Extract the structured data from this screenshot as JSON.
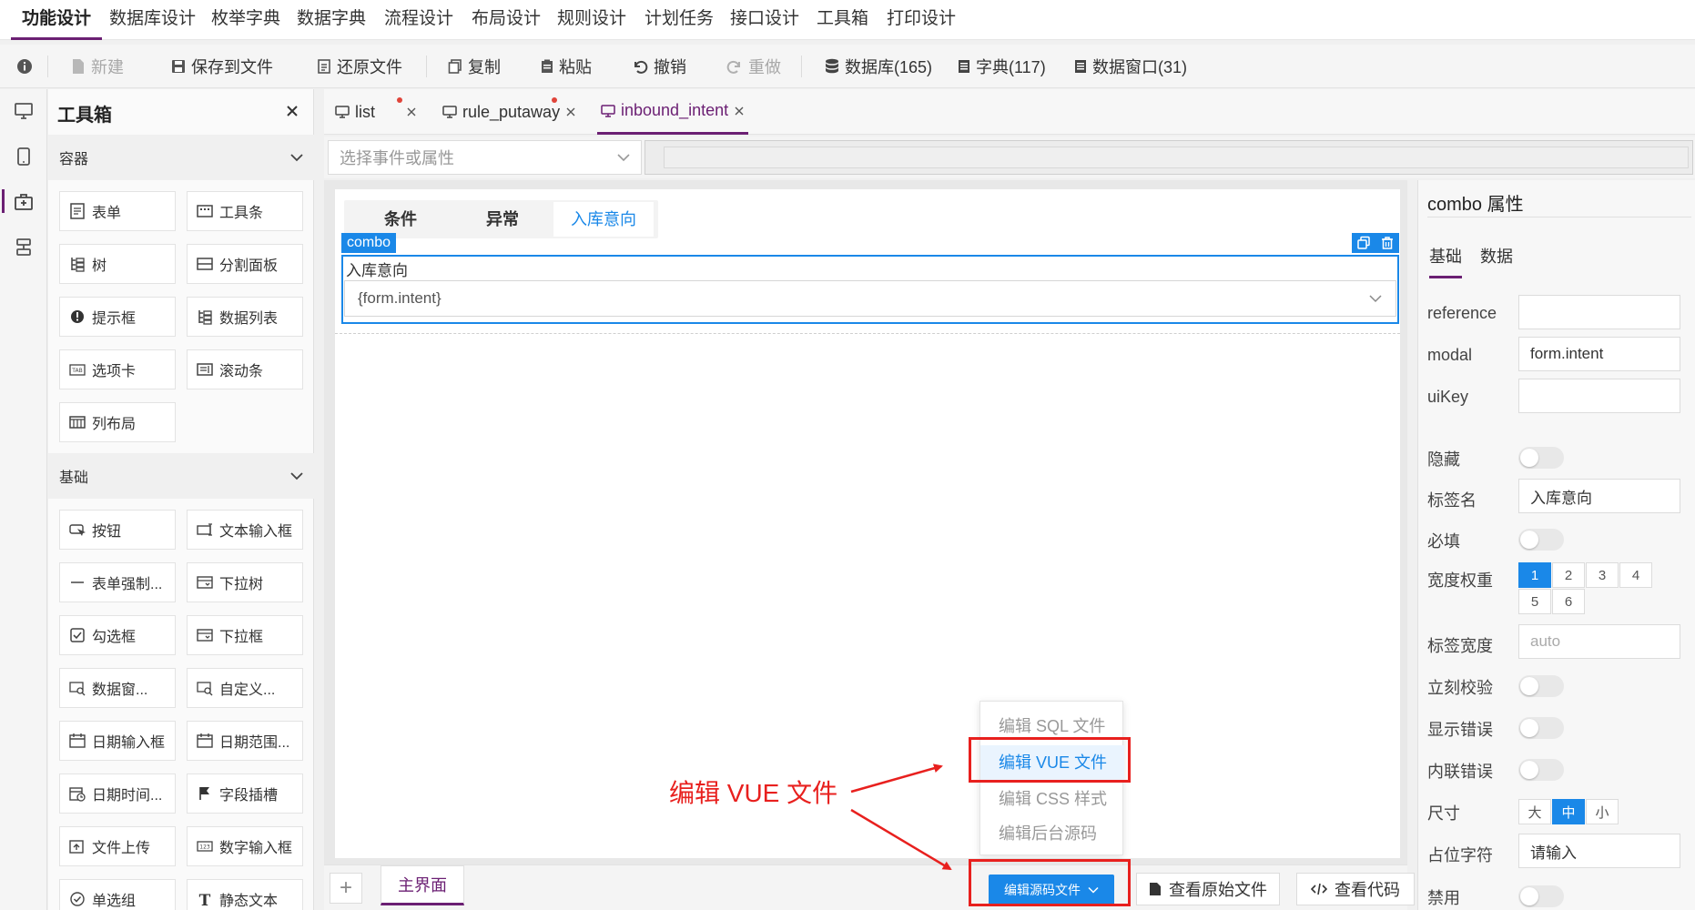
{
  "menu": [
    {
      "label": "功能设计",
      "active": true
    },
    {
      "label": "数据库设计"
    },
    {
      "label": "枚举字典"
    },
    {
      "label": "数据字典"
    },
    {
      "label": "流程设计"
    },
    {
      "label": "布局设计"
    },
    {
      "label": "规则设计"
    },
    {
      "label": "计划任务"
    },
    {
      "label": "接口设计"
    },
    {
      "label": "工具箱"
    },
    {
      "label": "打印设计"
    }
  ],
  "toolbar": {
    "new": "新建",
    "save": "保存到文件",
    "restore": "还原文件",
    "copy": "复制",
    "paste": "粘贴",
    "undo": "撤销",
    "redo": "重做",
    "database": "数据库(165)",
    "dictionary": "字典(117)",
    "data_window": "数据窗口(31)"
  },
  "toolbox": {
    "title": "工具箱",
    "sections": [
      {
        "title": "容器",
        "items": [
          "表单",
          "工具条",
          "树",
          "分割面板",
          "提示框",
          "数据列表",
          "选项卡",
          "滚动条",
          "列布局"
        ]
      },
      {
        "title": "基础",
        "items": [
          "按钮",
          "文本输入框",
          "表单强制...",
          "下拉树",
          "勾选框",
          "下拉框",
          "数据窗...",
          "自定义...",
          "日期输入框",
          "日期范围...",
          "日期时间...",
          "字段插槽",
          "文件上传",
          "数字输入框",
          "单选组",
          "静态文本"
        ]
      }
    ]
  },
  "doc_tabs": [
    {
      "label": "list",
      "modified": true
    },
    {
      "label": "rule_putaway",
      "modified": true
    },
    {
      "label": "inbound_intent",
      "active": true
    }
  ],
  "event_select": {
    "placeholder": "选择事件或属性"
  },
  "form_tabs": [
    "条件",
    "异常",
    "入库意向"
  ],
  "form_tab_active": 2,
  "combo": {
    "tag": "combo",
    "label": "入库意向",
    "value": "{form.intent}"
  },
  "bottom": {
    "add": "+",
    "page_tab": "主界面",
    "edit_source": "编辑源码文件",
    "view_original": "查看原始文件",
    "view_code": "查看代码"
  },
  "dropdown": {
    "items": [
      "编辑 SQL 文件",
      "编辑 VUE 文件",
      "编辑 CSS 样式",
      "编辑后台源码"
    ],
    "hover_index": 1
  },
  "annotation": {
    "text": "编辑 VUE 文件",
    "color": "#e8201e"
  },
  "props": {
    "title": "combo 属性",
    "tabs": [
      "基础",
      "数据"
    ],
    "reference": {
      "label": "reference",
      "value": ""
    },
    "modal": {
      "label": "modal",
      "value": "form.intent"
    },
    "uikey": {
      "label": "uiKey",
      "value": ""
    },
    "hidden": {
      "label": "隐藏",
      "on": false
    },
    "label_name": {
      "label": "标签名",
      "value": "入库意向"
    },
    "required": {
      "label": "必填",
      "on": false
    },
    "width_weight": {
      "label": "宽度权重",
      "options": [
        "1",
        "2",
        "3",
        "4",
        "5",
        "6"
      ],
      "selected": "1"
    },
    "label_width": {
      "label": "标签宽度",
      "placeholder": "auto"
    },
    "instant_validate": {
      "label": "立刻校验",
      "on": false
    },
    "show_error": {
      "label": "显示错误",
      "on": false
    },
    "inline_error": {
      "label": "内联错误",
      "on": false
    },
    "size": {
      "label": "尺寸",
      "options": [
        "大",
        "中",
        "小"
      ],
      "selected": "中"
    },
    "placeholder": {
      "label": "占位字符",
      "value": "请输入"
    },
    "disabled": {
      "label": "禁用",
      "on": false
    }
  },
  "colors": {
    "accent": "#6b1f73",
    "primary": "#1a88e8",
    "annotation": "#e8201e"
  }
}
